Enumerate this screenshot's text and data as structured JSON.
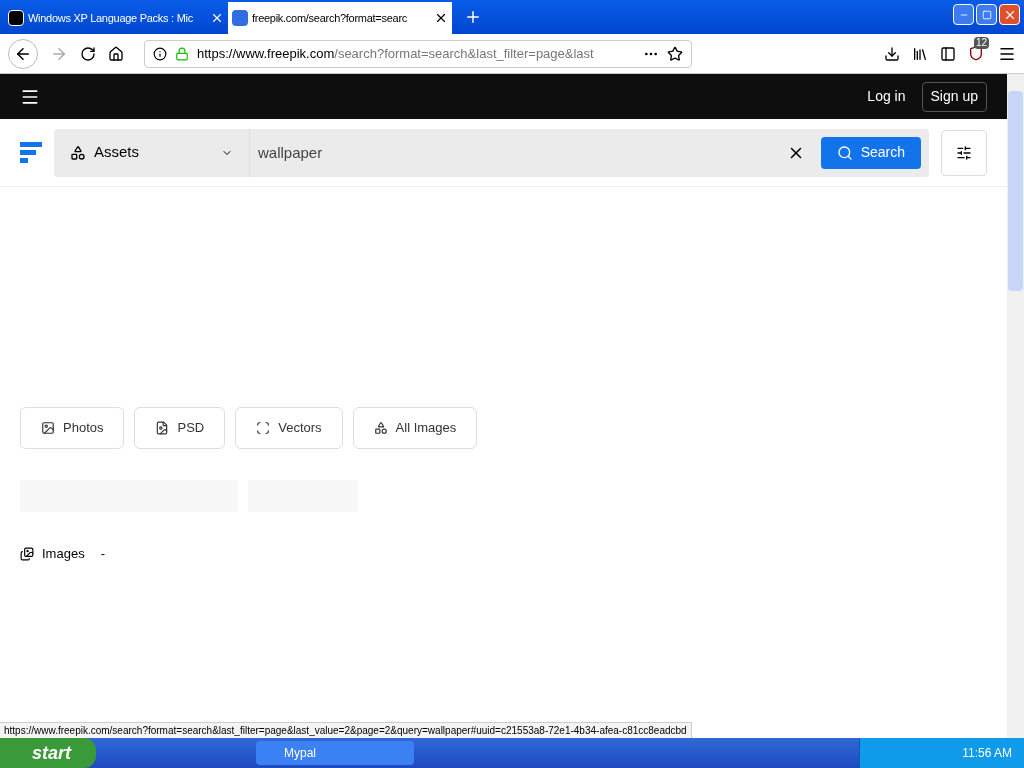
{
  "browser": {
    "tabs": [
      {
        "title": "Windows XP Language Packs : Mic",
        "selected": false
      },
      {
        "title": "freepik.com/search?format=searc",
        "selected": true
      }
    ],
    "url": {
      "host": "https://www.freepik.com",
      "rest": "/search?format=search&last_filter=page&last"
    },
    "extension_badge": "12"
  },
  "header": {
    "login": "Log in",
    "signup": "Sign up"
  },
  "search": {
    "category": "Assets",
    "query": "wallpaper",
    "button": "Search"
  },
  "filters": [
    {
      "label": "Photos",
      "kind": "photo"
    },
    {
      "label": "PSD",
      "kind": "psd"
    },
    {
      "label": "Vectors",
      "kind": "vector"
    },
    {
      "label": "All Images",
      "kind": "all"
    }
  ],
  "section": {
    "label": "Images",
    "count": "-"
  },
  "status_url": "https://www.freepik.com/search?format=search&last_filter=page&last_value=2&page=2&query=wallpaper#uuid=c21553a8-72e1-4b34-afea-c81cc8eadcbd",
  "taskbar": {
    "start": "start",
    "tasks": [
      {
        "label": "Mypal",
        "selected": false
      }
    ],
    "clock": "11:56 AM"
  }
}
